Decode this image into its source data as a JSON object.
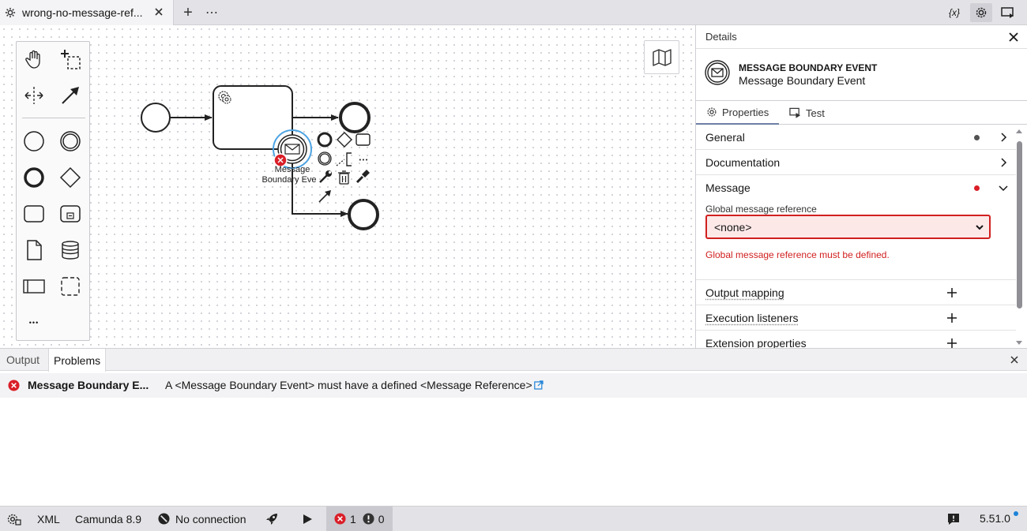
{
  "tabbar": {
    "tab_title": "wrong-no-message-ref...",
    "add_label": "+",
    "more_label": "⋯",
    "variables_label": "{x}"
  },
  "canvas": {
    "element_label_line1": "Message",
    "element_label_line2": "Boundary Eve",
    "more_tools_label": "•••",
    "context_more_label": "•••"
  },
  "details": {
    "title": "Details",
    "element_type": "MESSAGE BOUNDARY EVENT",
    "element_name": "Message Boundary Event",
    "tabs": [
      {
        "label": "Properties",
        "active": true
      },
      {
        "label": "Test",
        "active": false
      }
    ],
    "groups": {
      "general": {
        "label": "General",
        "dot_color": "#525252"
      },
      "documentation": {
        "label": "Documentation"
      },
      "message": {
        "label": "Message",
        "dot_color": "#da1e28"
      },
      "output_mapping": {
        "label": "Output mapping"
      },
      "execution_listeners": {
        "label": "Execution listeners"
      },
      "extension_properties": {
        "label": "Extension properties"
      }
    },
    "message_ref": {
      "label": "Global message reference",
      "value": "<none>",
      "error": "Global message reference must be defined."
    }
  },
  "bottom": {
    "tabs": [
      {
        "label": "Output",
        "active": false
      },
      {
        "label": "Problems",
        "active": true
      }
    ],
    "problems": [
      {
        "element": "Message Boundary E...",
        "message": "A <Message Boundary Event> must have a defined <Message Reference>"
      }
    ]
  },
  "statusbar": {
    "xml_label": "XML",
    "engine_label": "Camunda 8.9",
    "connection_label": "No connection",
    "error_count": "1",
    "warning_count": "0",
    "version": "5.51.0"
  },
  "colors": {
    "accent": "#1d82d7",
    "error": "#da1e28",
    "selection": "#4da3e2"
  }
}
